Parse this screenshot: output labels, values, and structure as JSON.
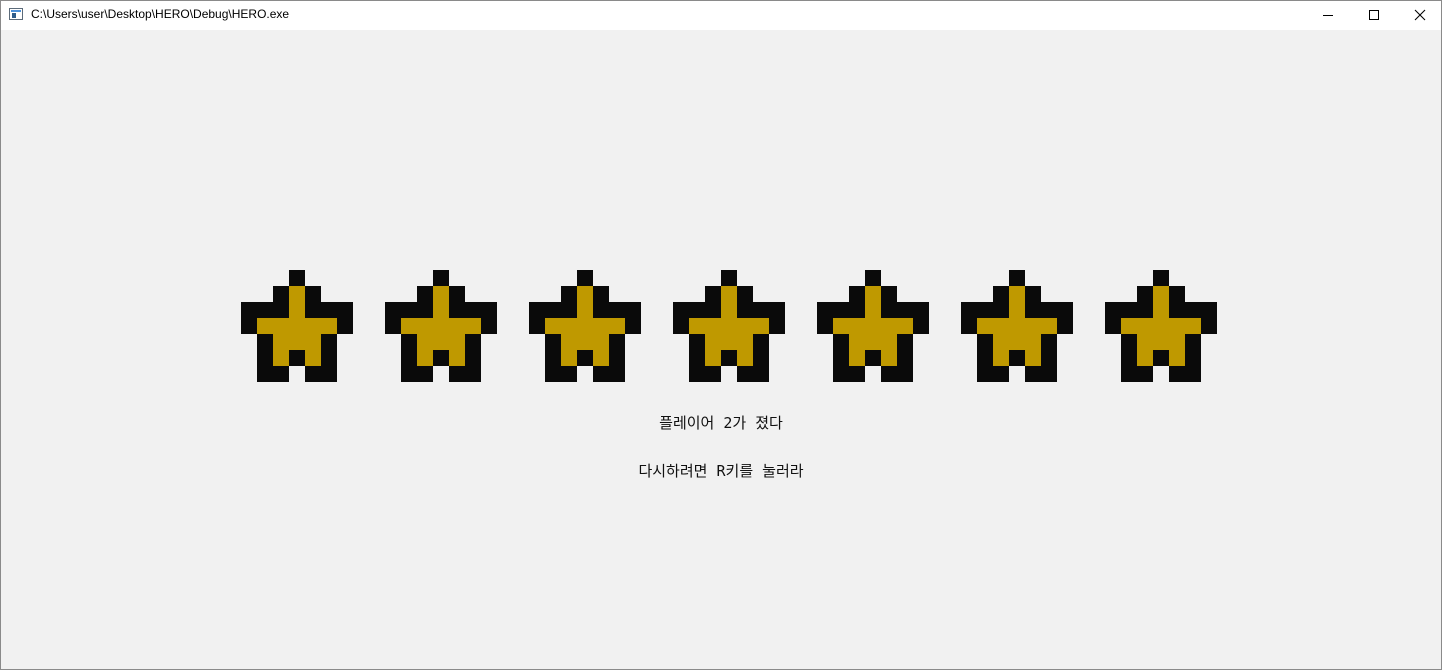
{
  "window": {
    "title": "C:\\Users\\user\\Desktop\\HERO\\Debug\\HERO.exe",
    "controls": {
      "minimize_icon": "minimize-icon",
      "maximize_icon": "maximize-icon",
      "close_icon": "close-icon"
    }
  },
  "game": {
    "star_count": 7,
    "star_colors": {
      "outline": "#0a0a0a",
      "fill": "#bf9900"
    },
    "result_text": "플레이어 2가 졌다",
    "restart_text": "다시하려면 R키를 눌러라"
  }
}
